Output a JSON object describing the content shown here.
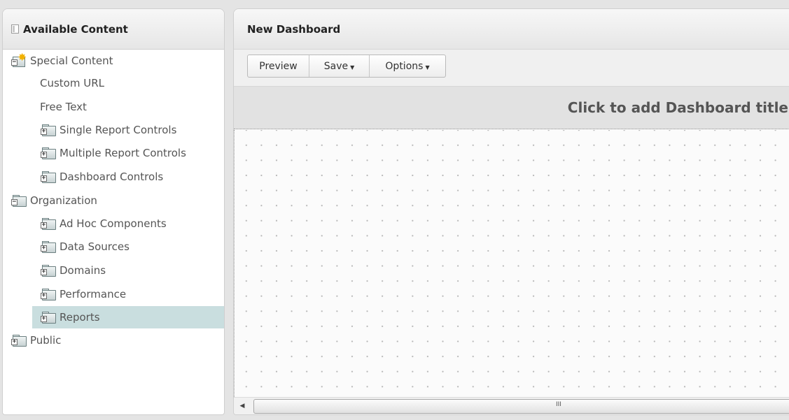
{
  "left_panel": {
    "title": "Available Content",
    "items": [
      {
        "label": "Special Content",
        "icon": "special-content-folder-icon",
        "level": 0,
        "expanded": true
      },
      {
        "label": "Custom URL",
        "icon": "none",
        "level": 1
      },
      {
        "label": "Free Text",
        "icon": "none",
        "level": 1
      },
      {
        "label": "Single Report Controls",
        "icon": "folder-icon",
        "level": 1,
        "expanded": false
      },
      {
        "label": "Multiple Report Controls",
        "icon": "folder-icon",
        "level": 1,
        "expanded": false
      },
      {
        "label": "Dashboard Controls",
        "icon": "folder-icon",
        "level": 1,
        "expanded": false
      },
      {
        "label": "Organization",
        "icon": "folder-icon",
        "level": 0,
        "expanded": true
      },
      {
        "label": "Ad Hoc Components",
        "icon": "folder-icon",
        "level": 1,
        "expanded": false
      },
      {
        "label": "Data Sources",
        "icon": "folder-icon",
        "level": 1,
        "expanded": false
      },
      {
        "label": "Domains",
        "icon": "folder-icon",
        "level": 1,
        "expanded": false
      },
      {
        "label": "Performance",
        "icon": "folder-icon",
        "level": 1,
        "expanded": false
      },
      {
        "label": "Reports",
        "icon": "folder-icon",
        "level": 1,
        "expanded": false,
        "selected": true
      },
      {
        "label": "Public",
        "icon": "folder-icon",
        "level": 0,
        "expanded": false
      }
    ]
  },
  "dashboard": {
    "name": "New Dashboard",
    "toolbar": {
      "preview_label": "Preview",
      "save_label": "Save",
      "options_label": "Options"
    },
    "title_placeholder": "Click to add Dashboard title",
    "scrollbar_grip": "III"
  },
  "colors": {
    "selected_row": "#c9dedf",
    "canvas_background": "#fbfbfb",
    "title_bar": "#e2e2e2"
  }
}
